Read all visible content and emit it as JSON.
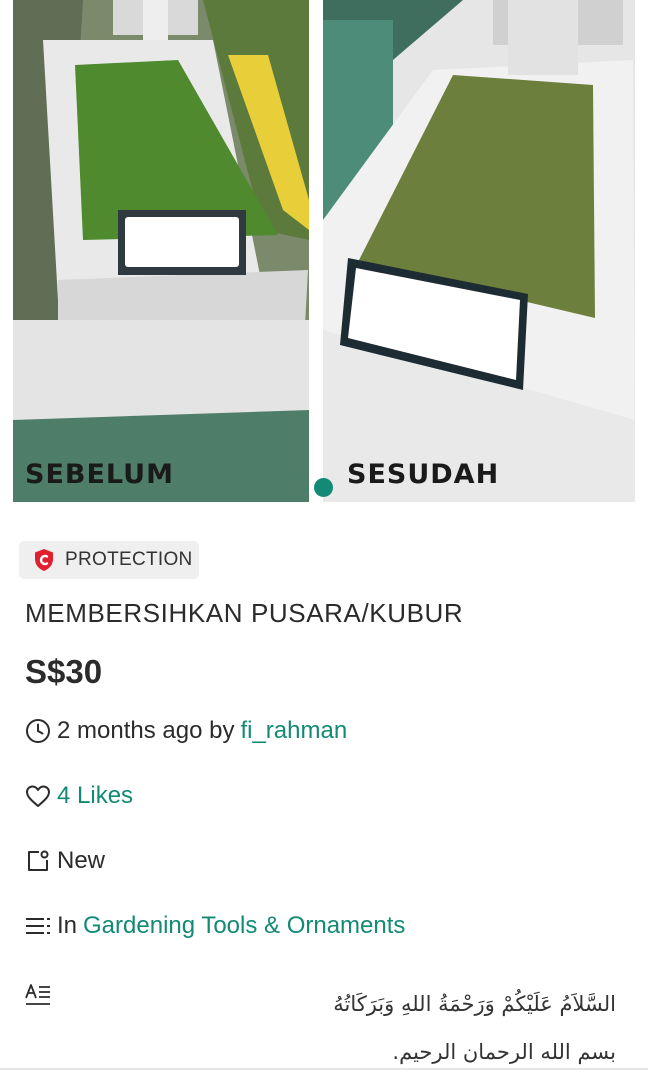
{
  "gallery": {
    "left_label": "SEBELUM",
    "right_label": "SESUDAH",
    "indicator_color": "#138a75"
  },
  "listing": {
    "badge": "PROTECTION",
    "title": "MEMBERSIHKAN PUSARA/KUBUR",
    "price": "S$30",
    "time_ago": "2 months ago by",
    "seller": "fi_rahman",
    "likes": "4 Likes",
    "condition": "New",
    "category_prefix": "In",
    "category": "Gardening Tools & Ornaments",
    "description_line1": "السَّلاَمُ عَلَيْكُمْ وَرَحْمَةُ اللهِ وَبَرَكَاتُهُ",
    "description_line2": "بسم الله الرحمان الرحيم."
  },
  "icons": {
    "badge": "shield-icon",
    "time": "clock-icon",
    "likes": "heart-icon",
    "condition": "tag-icon",
    "category": "list-icon",
    "description": "translate-icon"
  },
  "colors": {
    "accent": "#138a75",
    "badge_shield": "#e0202f",
    "text": "#2b2b2b"
  }
}
